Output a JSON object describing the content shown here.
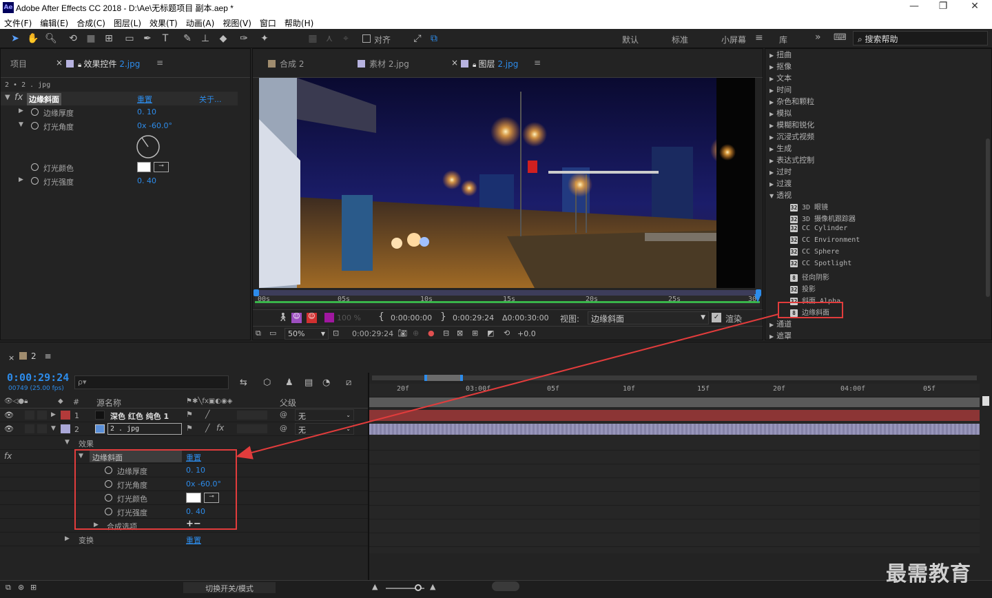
{
  "window": {
    "logo": "Ae",
    "title": "Adobe After Effects CC 2018 - D:\\Ae\\无标题项目 副本.aep *",
    "controls": [
      "—",
      "❐",
      "✕"
    ]
  },
  "menu": [
    "文件(F)",
    "编辑(E)",
    "合成(C)",
    "图层(L)",
    "效果(T)",
    "动画(A)",
    "视图(V)",
    "窗口",
    "帮助(H)"
  ],
  "toolbar": {
    "align_label": "对齐",
    "workspaces": [
      "默认",
      "标准",
      "小屏幕",
      "库"
    ],
    "active_workspace": "小屏幕",
    "search_placeholder": "搜索帮助"
  },
  "left_panel": {
    "tab_project": "项目",
    "tab_effects_prefix": "效果控件",
    "tab_effects_file": "2.jpg",
    "breadcrumb": "2 • 2 . jpg",
    "effect_name": "边缘斜面",
    "reset": "重置",
    "about": "关于...",
    "props": [
      {
        "label": "边缘厚度",
        "value": "0. 10"
      },
      {
        "label": "灯光角度",
        "value": "0x -60.0°"
      },
      {
        "label": "灯光颜色",
        "value": ""
      },
      {
        "label": "灯光强度",
        "value": "0. 40"
      }
    ]
  },
  "viewer": {
    "tabs": [
      {
        "label": "合成",
        "file": "2",
        "color": "#a08c6e"
      },
      {
        "label": "素材",
        "file": "2.jpg",
        "color": "#b7b3e0"
      },
      {
        "label": "图层",
        "file": "2.jpg",
        "color": "#b7b3e0"
      }
    ],
    "ruler_ticks": [
      "00s",
      "05s",
      "10s",
      "15s",
      "20s",
      "25s",
      "30"
    ],
    "opacity": "100 %",
    "tc_start": "0:00:00:00",
    "tc_end": "0:00:29:24",
    "tc_duration": "Δ0:00:30:00",
    "view_label": "视图:",
    "view_value": "边缘斜面",
    "render_label": "渲染",
    "zoom": "50%",
    "current_time": "0:00:29:24",
    "exposure": "+0.0"
  },
  "effects_list": {
    "categories_top": [
      "扭曲",
      "抠像",
      "文本",
      "时间",
      "杂色和颗粒",
      "模拟",
      "模糊和锐化",
      "沉浸式视频",
      "生成",
      "表达式控制",
      "过时",
      "过渡"
    ],
    "open_category": "透视",
    "items": [
      {
        "label": "3D 眼镜",
        "badge": "32"
      },
      {
        "label": "3D 摄像机跟踪器",
        "badge": "32"
      },
      {
        "label": "CC Cylinder",
        "badge": "32"
      },
      {
        "label": "CC Environment",
        "badge": "32"
      },
      {
        "label": "CC Sphere",
        "badge": "32"
      },
      {
        "label": "CC Spotlight",
        "badge": "32"
      },
      {
        "label": "径向阴影",
        "badge": "8"
      },
      {
        "label": "投影",
        "badge": "32"
      },
      {
        "label": "斜面 Alpha",
        "badge": "32"
      },
      {
        "label": "边缘斜面",
        "badge": "8"
      }
    ],
    "categories_bottom": [
      "通道",
      "遮罩"
    ]
  },
  "timeline": {
    "comp_tab": "2",
    "timecode": "0:00:29:24",
    "fps": "00749 (25.00 fps)",
    "search_placeholder": "ρ▾",
    "col_num": "#",
    "col_source": "源名称",
    "col_parent": "父级",
    "ruler": [
      "20f",
      "03:00f",
      "05f",
      "10f",
      "15f",
      "20f",
      "04:00f",
      "05f"
    ],
    "layers": [
      {
        "num": "1",
        "name": "深色 红色 纯色 1",
        "color": "#b33a3a",
        "parent": "无"
      },
      {
        "num": "2",
        "name": "2 . jpg",
        "color": "#aaa8d8",
        "parent": "无"
      }
    ],
    "effects_group": "效果",
    "effect_name": "边缘斜面",
    "reset": "重置",
    "props": [
      {
        "label": "边缘厚度",
        "value": "0. 10"
      },
      {
        "label": "灯光角度",
        "value": "0x -60.0°"
      },
      {
        "label": "灯光颜色",
        "value": ""
      },
      {
        "label": "灯光强度",
        "value": "0. 40"
      }
    ],
    "composite_label": "合成选项",
    "composite_value": "+−",
    "transform_label": "变换",
    "transform_reset": "重置",
    "switch_label": "切换开关/模式"
  },
  "watermark": "最需教育",
  "colors": {
    "accent": "#2d8ceb",
    "highlight": "#e23c3c",
    "layer1": "#8c3535",
    "layer2": "#8e8cb0"
  }
}
